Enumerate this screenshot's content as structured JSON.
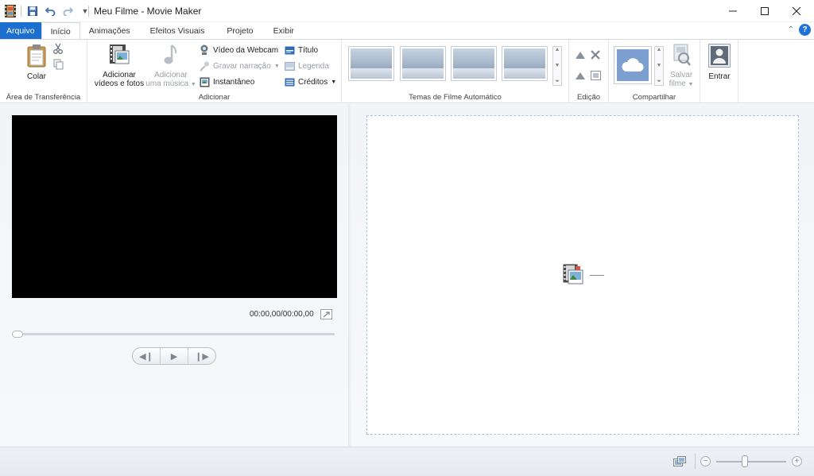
{
  "window": {
    "title": "Meu Filme - Movie Maker"
  },
  "ribbon_tabs": [
    {
      "label": "Arquivo"
    },
    {
      "label": "Início"
    },
    {
      "label": "Animações"
    },
    {
      "label": "Efeitos Visuais"
    },
    {
      "label": "Projeto"
    },
    {
      "label": "Exibir"
    }
  ],
  "help": {
    "label": "?"
  },
  "groups": {
    "clipboard": {
      "label": "Área de Transferência",
      "paste_label": "Colar"
    },
    "add": {
      "label": "Adicionar",
      "add_videos_line1": "Adicionar",
      "add_videos_line2": "vídeos e fotos",
      "add_music_line1": "Adicionar",
      "add_music_line2": "uma música",
      "webcam_video": "Vídeo da Webcam",
      "record_narration": "Gravar narração",
      "snapshot": "Instantâneo",
      "title": "Título",
      "caption": "Legenda",
      "credits": "Créditos"
    },
    "themes": {
      "label": "Temas de Filme Automático"
    },
    "editing": {
      "label": "Edição"
    },
    "share": {
      "label": "Compartilhar",
      "save_movie_line1": "Salvar",
      "save_movie_line2": "filme"
    },
    "signin": {
      "label": "Entrar"
    }
  },
  "preview": {
    "time": "00:00,00/00:00,00"
  },
  "colors": {
    "accent": "#1d6fcf",
    "storyboard_border": "#a9c3e6"
  }
}
